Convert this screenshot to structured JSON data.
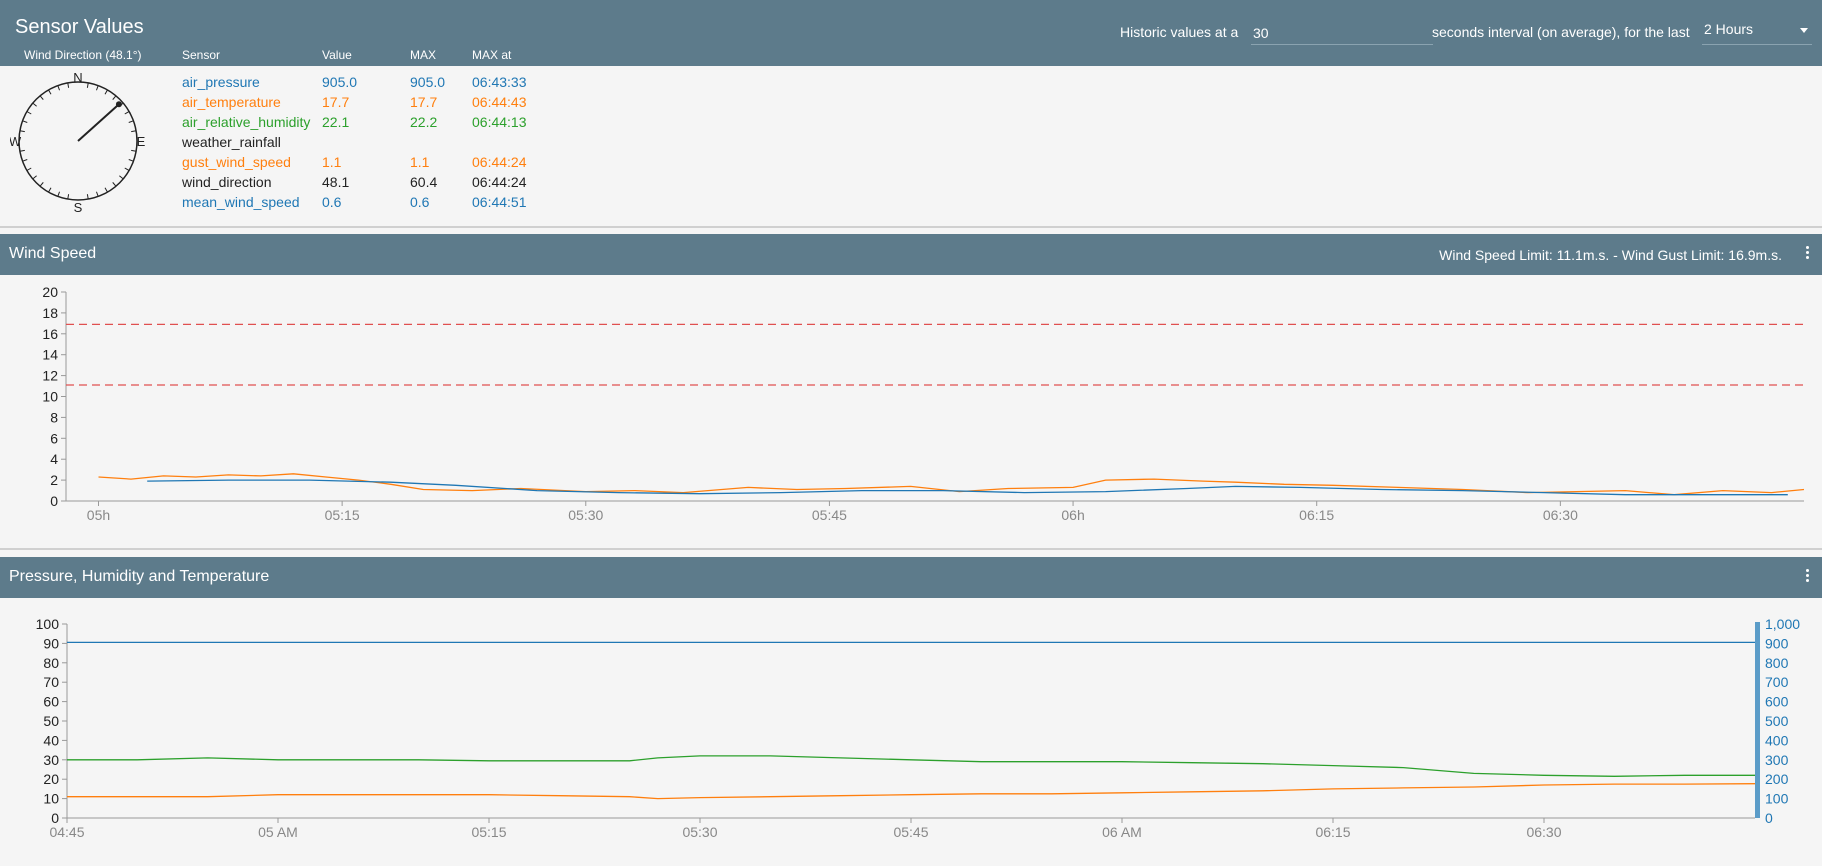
{
  "header": {
    "title": "Sensor Values",
    "hist_prefix": "Historic values at a",
    "hist_interval_value": "30",
    "hist_suffix": "seconds interval (on average), for the last",
    "hist_range": "2 Hours"
  },
  "table": {
    "compass_label": "Wind Direction (48.1°)",
    "col_sensor": "Sensor",
    "col_value": "Value",
    "col_max": "MAX",
    "col_max_at": "MAX at",
    "rows": [
      {
        "sensor": "air_pressure",
        "value": "905.0",
        "max": "905.0",
        "max_at": "06:43:33",
        "color": "#1f77b4"
      },
      {
        "sensor": "air_temperature",
        "value": "17.7",
        "max": "17.7",
        "max_at": "06:44:43",
        "color": "#ff7f0e"
      },
      {
        "sensor": "air_relative_humidity",
        "value": "22.1",
        "max": "22.2",
        "max_at": "06:44:13",
        "color": "#2ca02c"
      },
      {
        "sensor": "weather_rainfall",
        "value": "",
        "max": "",
        "max_at": "",
        "color": "#222222"
      },
      {
        "sensor": "gust_wind_speed",
        "value": "1.1",
        "max": "1.1",
        "max_at": "06:44:24",
        "color": "#ff7f0e"
      },
      {
        "sensor": "wind_direction",
        "value": "48.1",
        "max": "60.4",
        "max_at": "06:44:24",
        "color": "#222222"
      },
      {
        "sensor": "mean_wind_speed",
        "value": "0.6",
        "max": "0.6",
        "max_at": "06:44:51",
        "color": "#1f77b4"
      }
    ]
  },
  "compass": {
    "direction_deg": 48.1,
    "n": "N",
    "e": "E",
    "s": "S",
    "w": "W"
  },
  "wind_panel": {
    "title": "Wind Speed",
    "limit_text": "Wind Speed Limit: 11.1m.s. - Wind Gust Limit: 16.9m.s."
  },
  "pht_panel": {
    "title": "Pressure, Humidity and Temperature"
  },
  "colors": {
    "header_bg": "#5d7b8b",
    "pressure": "#1f77b4",
    "temperature": "#ff7f0e",
    "humidity": "#2ca02c",
    "limit_line": "#e05050"
  },
  "chart_data": [
    {
      "type": "line",
      "xlim": [
        "04:58",
        "06:45"
      ],
      "ylim": [
        0,
        20
      ],
      "yticks": [
        "0",
        "2",
        "4",
        "6",
        "8",
        "10",
        "12",
        "14",
        "16",
        "18",
        "20"
      ],
      "xticks": [
        {
          "label": "05h",
          "t": "05:00"
        },
        {
          "label": "05:15",
          "t": "05:15"
        },
        {
          "label": "05:30",
          "t": "05:30"
        },
        {
          "label": "05:45",
          "t": "05:45"
        },
        {
          "label": "06h",
          "t": "06:00"
        },
        {
          "label": "06:15",
          "t": "06:15"
        },
        {
          "label": "06:30",
          "t": "06:30"
        }
      ],
      "limits": [
        11.1,
        16.9
      ],
      "series": [
        {
          "color": "#ff7f0e",
          "x": [
            "05:00",
            "05:02",
            "05:04",
            "05:06",
            "05:08",
            "05:10",
            "05:12",
            "05:14",
            "05:16",
            "05:18",
            "05:20",
            "05:23",
            "05:26",
            "05:30",
            "05:33",
            "05:36",
            "05:40",
            "05:43",
            "05:46",
            "05:50",
            "05:53",
            "05:56",
            "06:00",
            "06:02",
            "06:05",
            "06:08",
            "06:10",
            "06:13",
            "06:16",
            "06:20",
            "06:24",
            "06:28",
            "06:31",
            "06:34",
            "06:37",
            "06:40",
            "06:43",
            "06:45"
          ],
          "values": [
            2.3,
            2.1,
            2.4,
            2.3,
            2.5,
            2.4,
            2.6,
            2.3,
            2.0,
            1.6,
            1.1,
            1.0,
            1.2,
            0.9,
            1.0,
            0.8,
            1.3,
            1.1,
            1.2,
            1.4,
            0.9,
            1.2,
            1.3,
            2.0,
            2.1,
            1.9,
            1.8,
            1.6,
            1.5,
            1.3,
            1.1,
            0.8,
            0.9,
            1.0,
            0.6,
            1.0,
            0.8,
            1.1
          ]
        },
        {
          "color": "#1f77b4",
          "x": [
            "05:03",
            "05:08",
            "05:13",
            "05:18",
            "05:22",
            "05:27",
            "05:32",
            "05:37",
            "05:42",
            "05:47",
            "05:52",
            "05:57",
            "06:02",
            "06:07",
            "06:10",
            "06:14",
            "06:19",
            "06:24",
            "06:29",
            "06:34",
            "06:39",
            "06:44"
          ],
          "values": [
            1.9,
            2.0,
            2.0,
            1.8,
            1.5,
            1.0,
            0.8,
            0.7,
            0.8,
            1.0,
            1.0,
            0.8,
            0.9,
            1.2,
            1.4,
            1.3,
            1.1,
            1.0,
            0.8,
            0.6,
            0.6,
            0.6
          ]
        }
      ]
    },
    {
      "type": "line",
      "xlim": [
        "04:45",
        "06:45"
      ],
      "ylim": [
        0,
        100
      ],
      "ylim_right": [
        0,
        1000
      ],
      "yticks": [
        "0",
        "10",
        "20",
        "30",
        "40",
        "50",
        "60",
        "70",
        "80",
        "90",
        "100"
      ],
      "yticks_right": [
        "0",
        "100",
        "200",
        "300",
        "400",
        "500",
        "600",
        "700",
        "800",
        "900",
        "1,000"
      ],
      "xticks": [
        {
          "label": "04:45",
          "t": "04:45"
        },
        {
          "label": "05 AM",
          "t": "05:00"
        },
        {
          "label": "05:15",
          "t": "05:15"
        },
        {
          "label": "05:30",
          "t": "05:30"
        },
        {
          "label": "05:45",
          "t": "05:45"
        },
        {
          "label": "06 AM",
          "t": "06:00"
        },
        {
          "label": "06:15",
          "t": "06:15"
        },
        {
          "label": "06:30",
          "t": "06:30"
        }
      ],
      "series": [
        {
          "color": "#1f77b4",
          "axis": "right",
          "x": [
            "04:45",
            "06:45"
          ],
          "values": [
            905,
            905
          ]
        },
        {
          "color": "#2ca02c",
          "axis": "left",
          "x": [
            "04:45",
            "04:50",
            "04:55",
            "05:00",
            "05:05",
            "05:10",
            "05:15",
            "05:20",
            "05:25",
            "05:27",
            "05:30",
            "05:35",
            "05:40",
            "05:45",
            "05:50",
            "05:55",
            "06:00",
            "06:05",
            "06:10",
            "06:15",
            "06:20",
            "06:25",
            "06:30",
            "06:35",
            "06:40",
            "06:45"
          ],
          "values": [
            30,
            30,
            31,
            30,
            30,
            30,
            29.5,
            29.5,
            29.5,
            31,
            32,
            32,
            31,
            30,
            29,
            29,
            29,
            28.5,
            28,
            27,
            26,
            23,
            22,
            21.5,
            22,
            22
          ]
        },
        {
          "color": "#ff7f0e",
          "axis": "left",
          "x": [
            "04:45",
            "04:50",
            "04:55",
            "05:00",
            "05:05",
            "05:10",
            "05:15",
            "05:20",
            "05:25",
            "05:27",
            "05:30",
            "05:35",
            "05:40",
            "05:45",
            "05:50",
            "05:55",
            "06:00",
            "06:05",
            "06:10",
            "06:15",
            "06:20",
            "06:25",
            "06:30",
            "06:35",
            "06:40",
            "06:45"
          ],
          "values": [
            11,
            11,
            11,
            12,
            12,
            12,
            12,
            11.5,
            11,
            10,
            10.5,
            11,
            11.5,
            12,
            12.5,
            12.5,
            13,
            13.5,
            14,
            15,
            15.5,
            16,
            17,
            17.5,
            17.5,
            17.7
          ]
        }
      ]
    }
  ]
}
